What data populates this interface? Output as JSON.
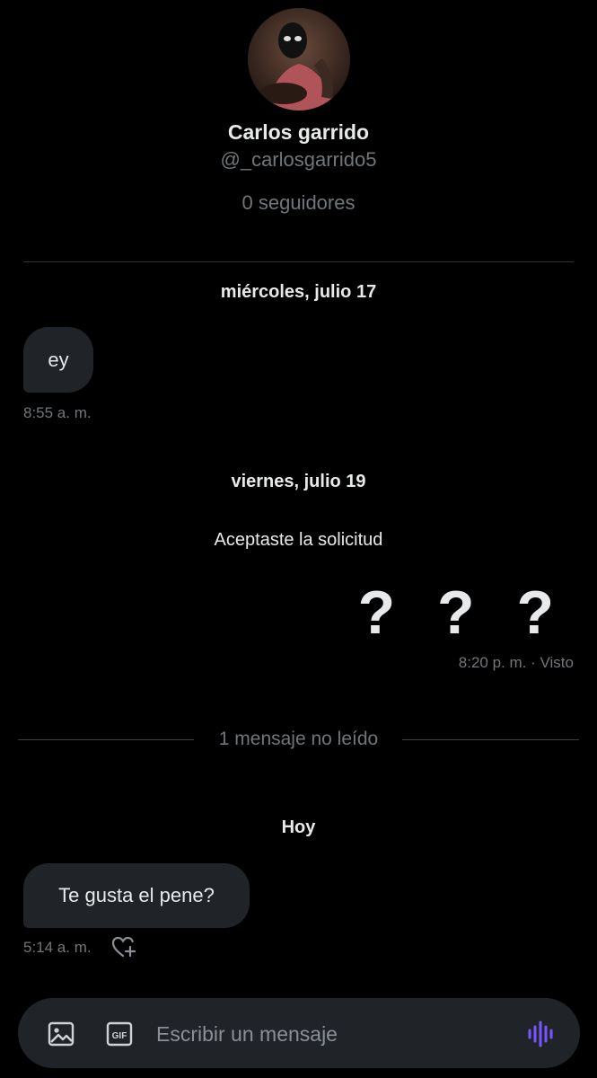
{
  "profile": {
    "name": "Carlos garrido",
    "handle": "@_carlosgarrido5",
    "followers": "0 seguidores"
  },
  "messages": {
    "date1": "miércoles, julio 17",
    "msg1": {
      "text": "ey",
      "time": "8:55 a. m."
    },
    "date2": "viernes, julio 19",
    "system": "Aceptaste la solicitud",
    "msg2": {
      "text": "? ? ?",
      "status": "8:20 p. m. · Visto"
    },
    "unread": "1 mensaje no leído",
    "date3": "Hoy",
    "msg3": {
      "text": "Te gusta el pene?",
      "time": "5:14 a. m."
    }
  },
  "composer": {
    "placeholder": "Escribir un mensaje",
    "gif_label": "GIF",
    "image_icon": "image-icon",
    "gif_icon": "gif-icon",
    "voice_icon": "voice-wave-icon"
  },
  "colors": {
    "background": "#000000",
    "bubble": "#202327",
    "muted": "#71767b",
    "accent": "#7856ff"
  }
}
